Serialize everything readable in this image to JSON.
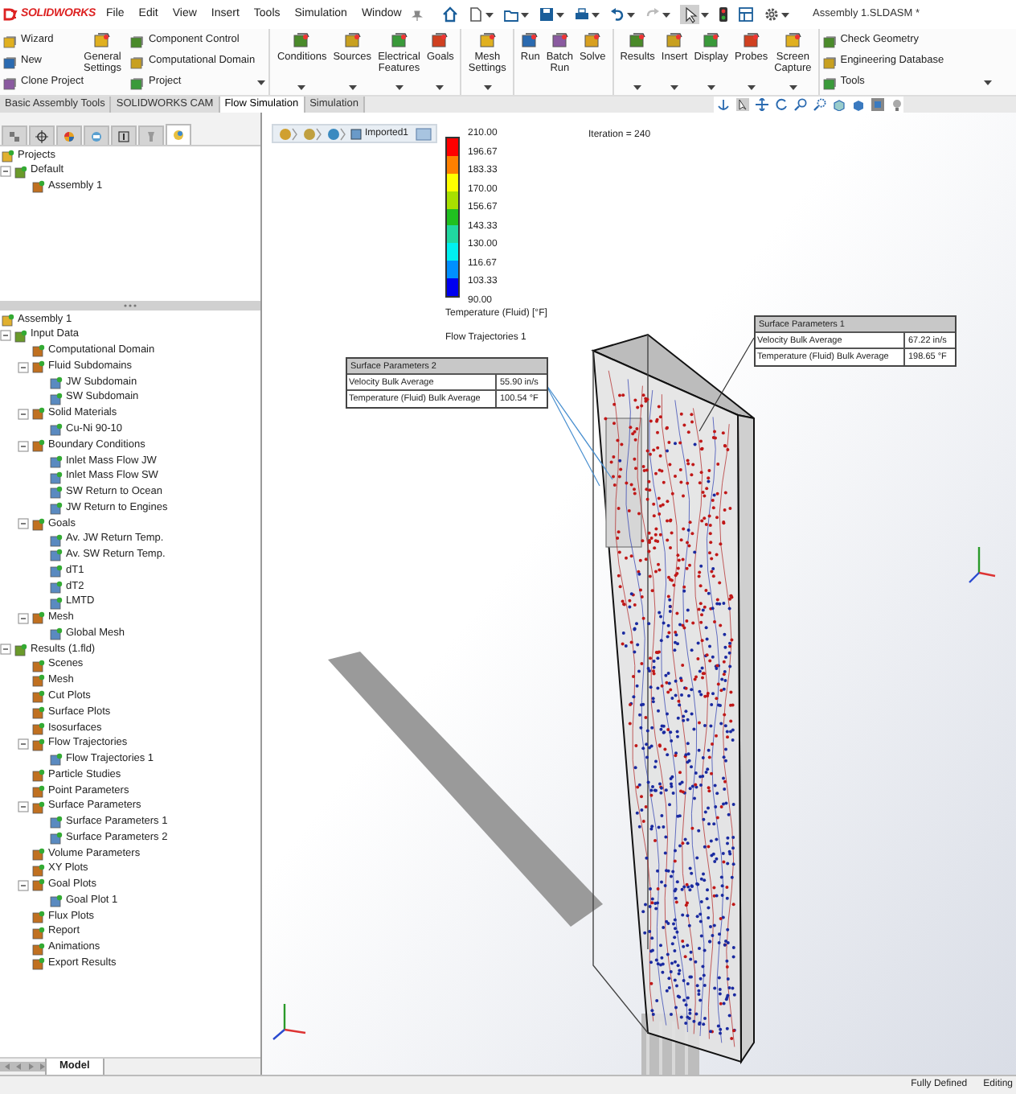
{
  "app": {
    "logo": "SOLIDWORKS",
    "document_title": "Assembly 1.SLDASM *"
  },
  "menu": [
    "File",
    "Edit",
    "View",
    "Insert",
    "Tools",
    "Simulation",
    "Window"
  ],
  "ribbon": [
    {
      "kind": "stack",
      "items": [
        {
          "label": "Wizard",
          "dropdown": false
        },
        {
          "label": "New",
          "dropdown": false
        },
        {
          "label": "Clone Project",
          "dropdown": false
        }
      ]
    },
    {
      "kind": "large",
      "items": [
        {
          "label": "General Settings",
          "dropdown": false
        }
      ]
    },
    {
      "kind": "stack",
      "items": [
        {
          "label": "Component Control",
          "dropdown": false
        },
        {
          "label": "Computational Domain",
          "dropdown": false
        },
        {
          "label": "Project",
          "dropdown": true
        }
      ]
    },
    {
      "kind": "large",
      "items": [
        {
          "label": "Conditions",
          "dropdown": true
        },
        {
          "label": "Sources",
          "dropdown": true
        },
        {
          "label": "Electrical Features",
          "dropdown": true
        },
        {
          "label": "Goals",
          "dropdown": true
        }
      ]
    },
    {
      "kind": "large",
      "items": [
        {
          "label": "Mesh Settings",
          "dropdown": true
        }
      ]
    },
    {
      "kind": "large",
      "items": [
        {
          "label": "Run",
          "dropdown": false
        },
        {
          "label": "Batch Run",
          "dropdown": false
        },
        {
          "label": "Solve",
          "dropdown": false
        }
      ]
    },
    {
      "kind": "large",
      "items": [
        {
          "label": "Results",
          "dropdown": true
        },
        {
          "label": "Insert",
          "dropdown": true
        },
        {
          "label": "Display",
          "dropdown": true
        },
        {
          "label": "Probes",
          "dropdown": true
        },
        {
          "label": "Screen Capture",
          "dropdown": true
        }
      ]
    },
    {
      "kind": "stack",
      "items": [
        {
          "label": "Check Geometry",
          "dropdown": false
        },
        {
          "label": "Engineering Database",
          "dropdown": false
        },
        {
          "label": "Tools",
          "dropdown": true
        }
      ]
    }
  ],
  "command_tabs": [
    {
      "label": "Basic Assembly Tools",
      "selected": false
    },
    {
      "label": "SOLIDWORKS CAM",
      "selected": false
    },
    {
      "label": "Flow Simulation",
      "selected": true
    },
    {
      "label": "Simulation",
      "selected": false
    }
  ],
  "panel_tabs": [
    {
      "selected": false
    },
    {
      "selected": false
    },
    {
      "selected": false
    },
    {
      "selected": false
    },
    {
      "selected": false
    },
    {
      "selected": false
    },
    {
      "selected": true
    }
  ],
  "project_tree": {
    "label": "Projects",
    "children": [
      {
        "label": "Default",
        "expanded": true,
        "children": [
          {
            "label": "Assembly 1"
          }
        ]
      }
    ]
  },
  "feature_tree": {
    "label": "Assembly 1",
    "children": [
      {
        "label": "Input Data",
        "expanded": true,
        "children": [
          {
            "label": "Computational Domain"
          },
          {
            "label": "Fluid Subdomains",
            "expanded": true,
            "children": [
              {
                "label": "JW Subdomain"
              },
              {
                "label": "SW Subdomain"
              }
            ]
          },
          {
            "label": "Solid Materials",
            "expanded": true,
            "children": [
              {
                "label": "Cu-Ni 90-10"
              }
            ]
          },
          {
            "label": "Boundary Conditions",
            "expanded": true,
            "children": [
              {
                "label": "Inlet Mass Flow JW"
              },
              {
                "label": "Inlet Mass Flow SW"
              },
              {
                "label": "SW Return to Ocean"
              },
              {
                "label": "JW Return to Engines"
              }
            ]
          },
          {
            "label": "Goals",
            "expanded": true,
            "children": [
              {
                "label": "Av. JW Return Temp."
              },
              {
                "label": "Av. SW Return Temp."
              },
              {
                "label": "dT1"
              },
              {
                "label": "dT2"
              },
              {
                "label": "LMTD"
              }
            ]
          },
          {
            "label": "Mesh",
            "expanded": true,
            "children": [
              {
                "label": "Global Mesh"
              }
            ]
          }
        ]
      },
      {
        "label": "Results (1.fld)",
        "expanded": true,
        "children": [
          {
            "label": "Scenes"
          },
          {
            "label": "Mesh"
          },
          {
            "label": "Cut Plots"
          },
          {
            "label": "Surface Plots"
          },
          {
            "label": "Isosurfaces"
          },
          {
            "label": "Flow Trajectories",
            "expanded": true,
            "children": [
              {
                "label": "Flow Trajectories 1"
              }
            ]
          },
          {
            "label": "Particle Studies"
          },
          {
            "label": "Point Parameters"
          },
          {
            "label": "Surface Parameters",
            "expanded": true,
            "children": [
              {
                "label": "Surface Parameters 1"
              },
              {
                "label": "Surface Parameters 2"
              }
            ]
          },
          {
            "label": "Volume Parameters"
          },
          {
            "label": "XY Plots"
          },
          {
            "label": "Goal Plots",
            "expanded": true,
            "children": [
              {
                "label": "Goal Plot 1"
              }
            ]
          },
          {
            "label": "Flux Plots"
          },
          {
            "label": "Report"
          },
          {
            "label": "Animations"
          },
          {
            "label": "Export Results"
          }
        ]
      }
    ]
  },
  "bottom_tabs": [
    {
      "label": "Model",
      "selected": true
    }
  ],
  "viewport": {
    "breadcrumb": "Imported1",
    "iteration": "Iteration = 240",
    "legend": {
      "ticks": [
        "210.00",
        "196.67",
        "183.33",
        "170.00",
        "156.67",
        "143.33",
        "130.00",
        "116.67",
        "103.33",
        "90.00"
      ],
      "bands": [
        {
          "color": "#ff0000"
        },
        {
          "color": "#ff8000"
        },
        {
          "color": "#ffff00"
        },
        {
          "color": "#a8e000"
        },
        {
          "color": "#20c020"
        },
        {
          "color": "#20d8a0"
        },
        {
          "color": "#00f0f0"
        },
        {
          "color": "#0090ff"
        },
        {
          "color": "#0000f0"
        }
      ],
      "title": "Temperature (Fluid) [°F]"
    },
    "plot_name": "Flow Trajectories 1",
    "tables": [
      {
        "title": "Surface Parameters 1",
        "rows": [
          {
            "label": "Velocity Bulk Average",
            "value": "67.22 in/s"
          },
          {
            "label": "Temperature (Fluid) Bulk Average",
            "value": "198.65 °F"
          }
        ]
      },
      {
        "title": "Surface Parameters 2",
        "rows": [
          {
            "label": "Velocity Bulk Average",
            "value": "55.90 in/s"
          },
          {
            "label": "Temperature (Fluid) Bulk Average",
            "value": "100.54 °F"
          }
        ]
      }
    ]
  },
  "status_bar": [
    "Fully Defined",
    "Editing"
  ]
}
